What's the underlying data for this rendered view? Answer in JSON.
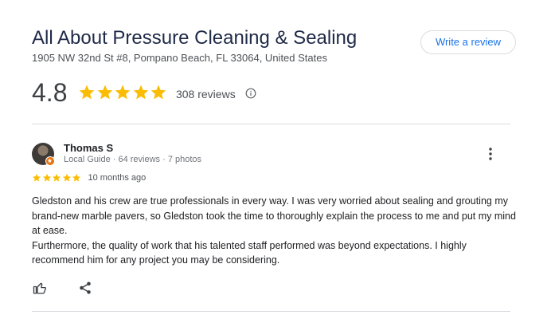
{
  "business": {
    "name": "All About Pressure Cleaning & Sealing",
    "address": "1905 NW 32nd St #8, Pompano Beach, FL 33064, United States",
    "rating": "4.8",
    "star_count": 5,
    "review_count": "308 reviews",
    "write_review_label": "Write a review"
  },
  "review": {
    "author": "Thomas S",
    "author_meta": "Local Guide · 64 reviews · 7 photos",
    "rating_stars": 5,
    "date": "10 months ago",
    "paragraphs": [
      "Gledston and his crew are true professionals in every way. I was very worried about sealing and grouting my brand-new marble pavers, so Gledston took the time to thoroughly explain the process to me and put my mind at ease.",
      "Furthermore, the quality of work that his talented staff performed was beyond expectations. I highly recommend him for any project you may be considering."
    ]
  },
  "icons": {
    "info": "info-icon",
    "more": "more-vertical-icon",
    "like": "thumbs-up-icon",
    "share": "share-icon",
    "local_guide_badge": "local-guide-badge-icon"
  },
  "colors": {
    "star": "#fbbc04",
    "link": "#1a73e8",
    "title": "#1f2a48",
    "badge": "#e8710a"
  }
}
